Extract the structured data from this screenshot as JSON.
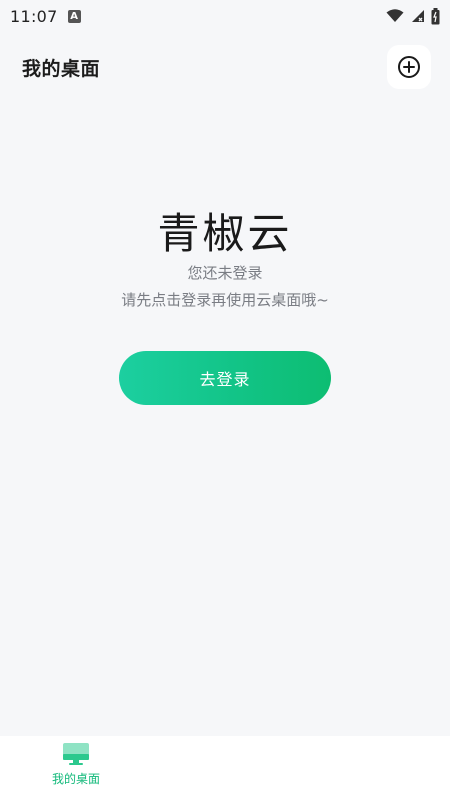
{
  "status_bar": {
    "time": "11:07",
    "notification_icon": "a-letter-icon",
    "icons": [
      "wifi-icon",
      "signal-icon",
      "battery-icon"
    ]
  },
  "header": {
    "title": "我的桌面",
    "add_icon": "plus-circle-icon"
  },
  "main": {
    "brand": "青椒云",
    "message_line1": "您还未登录",
    "message_line2": "请先点击登录再使用云桌面哦~",
    "login_button": "去登录"
  },
  "bottom_nav": {
    "items": [
      {
        "label": "我的桌面",
        "icon": "desktop-monitor-icon",
        "active": true
      }
    ]
  },
  "colors": {
    "accent": "#12c487",
    "accent_start": "#1ccfa0",
    "background": "#f6f7f9",
    "muted_text": "#7a7d84"
  }
}
